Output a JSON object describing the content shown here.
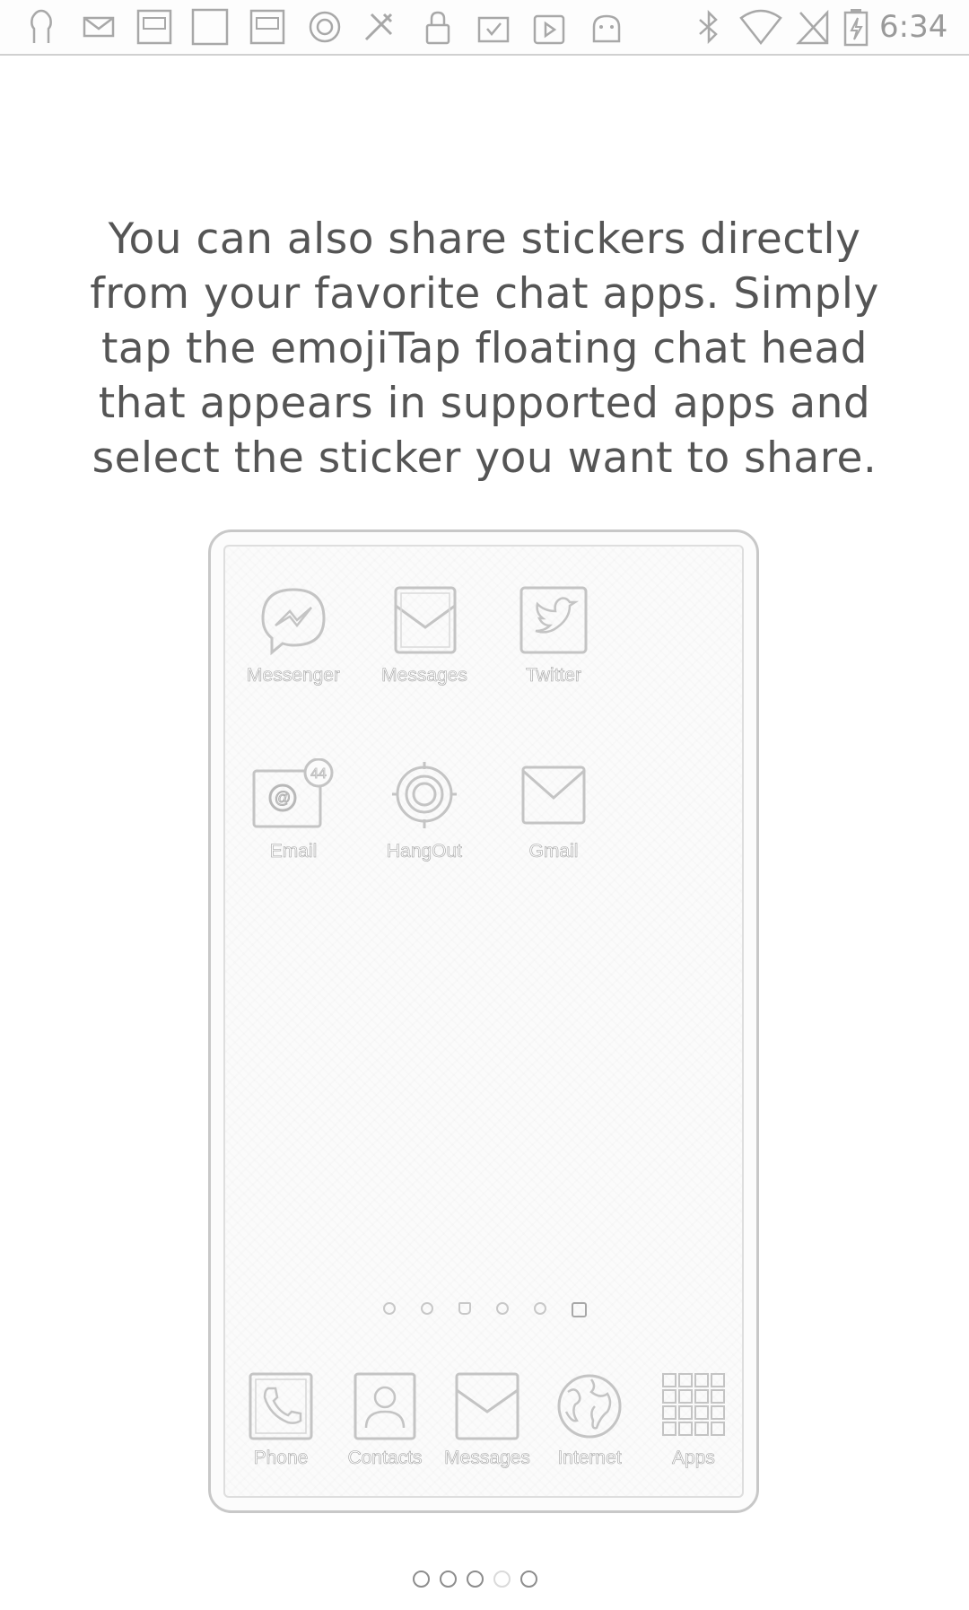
{
  "status_bar": {
    "time": "6:34",
    "icons": [
      "person-icon",
      "mail-icon",
      "kbs-app-icon",
      "blank-notification-icon",
      "kbs-app-icon",
      "circle-app-icon",
      "tools-icon",
      "lock-icon",
      "clipboard-check-icon",
      "play-store-icon",
      "android-icon",
      "bluetooth-icon",
      "wifi-icon",
      "no-signal-icon",
      "battery-charging-icon"
    ]
  },
  "instruction": {
    "text": "You can also share stickers directly from your favorite chat apps. Simply tap the emojiTap floating chat head that appears in supported apps and select the sticker you want to share."
  },
  "phone": {
    "apps": [
      {
        "label": "Messenger",
        "icon": "messenger-icon"
      },
      {
        "label": "Messages",
        "icon": "messages-icon"
      },
      {
        "label": "Twitter",
        "icon": "twitter-icon"
      },
      {
        "label": "Email",
        "icon": "email-icon",
        "badge": "44"
      },
      {
        "label": "HangOut",
        "icon": "hangout-icon"
      },
      {
        "label": "Gmail",
        "icon": "gmail-icon"
      }
    ],
    "dock": [
      {
        "label": "Phone",
        "icon": "phone-icon"
      },
      {
        "label": "Contacts",
        "icon": "contacts-icon"
      },
      {
        "label": "Messages",
        "icon": "messages-icon"
      },
      {
        "label": "Internet",
        "icon": "globe-icon"
      },
      {
        "label": "Apps",
        "icon": "apps-grid-icon"
      }
    ],
    "home_pages": 6,
    "home_page_active": 6
  },
  "pager": {
    "total": 5,
    "current": 4
  }
}
